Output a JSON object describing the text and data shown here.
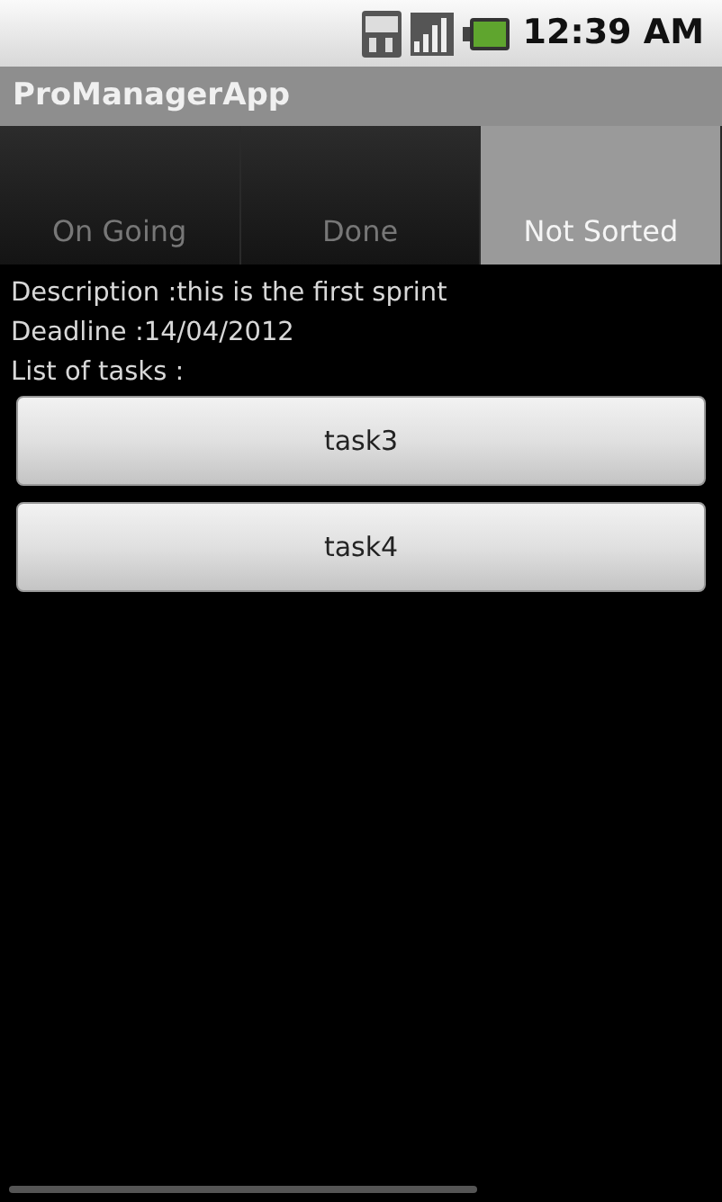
{
  "status_bar": {
    "time": "12:39 AM"
  },
  "window": {
    "title": "ProManagerApp"
  },
  "tabs": [
    {
      "label": "On Going",
      "selected": false
    },
    {
      "label": "Done",
      "selected": false
    },
    {
      "label": "Not Sorted",
      "selected": true
    }
  ],
  "details": [
    "Description :this is the first sprint",
    "Deadline :14/04/2012",
    "List of tasks :"
  ],
  "tasks": [
    "task3",
    "task4"
  ]
}
